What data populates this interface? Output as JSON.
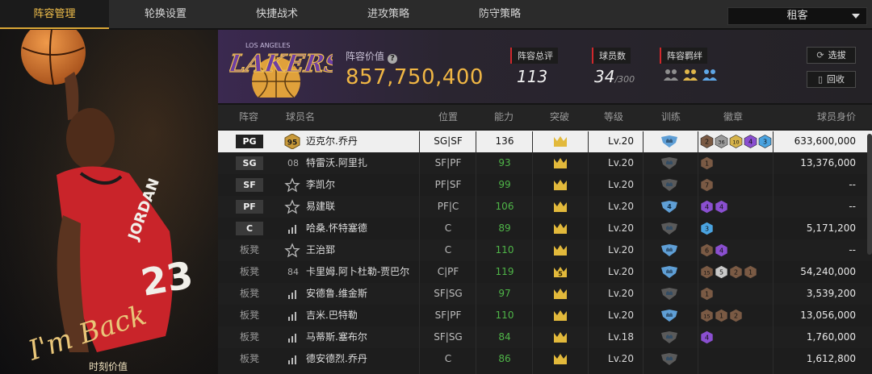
{
  "nav": {
    "tabs": [
      "阵容管理",
      "轮换设置",
      "快捷战术",
      "进攻策略",
      "防守策略"
    ],
    "active_tab": "阵容管理",
    "mode": "租客"
  },
  "promo": {
    "caption": "时刻价值",
    "jersey_text": "JORDAN",
    "jersey_number": "23",
    "signature": "I'm Back"
  },
  "team": {
    "logo_text": "LAKERS",
    "logo_subtext": "LOS ANGELES",
    "value_label": "阵容价值",
    "value": "857,750,400",
    "stats": [
      {
        "label": "阵容总评",
        "value": "113",
        "suffix": ""
      },
      {
        "label": "球员数",
        "value": "34",
        "suffix": "/300"
      },
      {
        "label": "阵容羁绊",
        "value": "",
        "suffix": ""
      }
    ],
    "buttons": {
      "draft": "选拔",
      "recycle": "回收"
    }
  },
  "table": {
    "headers": [
      "阵容",
      "球员名",
      "位置",
      "能力",
      "突破",
      "等级",
      "训练",
      "徽章",
      "球员身价"
    ],
    "rows": [
      {
        "slot": "PG",
        "rating": "95",
        "name": "迈克尔.乔丹",
        "position": "SG|SF",
        "ability": "136",
        "breakthrough": "",
        "level": "Lv.20",
        "badges": [
          "2",
          "36",
          "10",
          "4",
          "3"
        ],
        "price": "633,600,000"
      },
      {
        "slot": "SG",
        "rating": "08",
        "name": "特雷沃.阿里扎",
        "position": "SF|PF",
        "ability": "93",
        "breakthrough": "",
        "level": "Lv.20",
        "badges": [
          "1"
        ],
        "price": "13,376,000"
      },
      {
        "slot": "SF",
        "rating": "",
        "name": "李凯尔",
        "position": "PF|SF",
        "ability": "99",
        "breakthrough": "",
        "level": "Lv.20",
        "badges": [
          "7"
        ],
        "price": "--"
      },
      {
        "slot": "PF",
        "rating": "",
        "name": "易建联",
        "position": "PF|C",
        "ability": "106",
        "breakthrough": "",
        "level": "Lv.20",
        "train_level": "4",
        "badges": [
          "4",
          "4"
        ],
        "price": "--"
      },
      {
        "slot": "C",
        "rating": "",
        "name": "哈桑.怀特塞德",
        "position": "C",
        "ability": "89",
        "breakthrough": "",
        "level": "Lv.20",
        "badges": [
          "3"
        ],
        "price": "5,171,200"
      },
      {
        "slot": "板凳",
        "rating": "",
        "name": "王治郅",
        "position": "C",
        "ability": "110",
        "breakthrough": "",
        "level": "Lv.20",
        "badges": [
          "6",
          "4"
        ],
        "price": "--"
      },
      {
        "slot": "板凳",
        "rating": "84",
        "name": "卡里姆.阿卜杜勒-贾巴尔",
        "position": "C|PF",
        "ability": "119",
        "breakthrough": "5",
        "level": "Lv.20",
        "badges": [
          "15",
          "5",
          "2",
          "1"
        ],
        "price": "54,240,000"
      },
      {
        "slot": "板凳",
        "rating": "",
        "name": "安德鲁.维金斯",
        "position": "SF|SG",
        "ability": "97",
        "breakthrough": "",
        "level": "Lv.20",
        "badges": [
          "1"
        ],
        "price": "3,539,200"
      },
      {
        "slot": "板凳",
        "rating": "",
        "name": "吉米.巴特勒",
        "position": "SF|PF",
        "ability": "110",
        "breakthrough": "",
        "level": "Lv.20",
        "badges": [
          "15",
          "1",
          "2"
        ],
        "price": "13,056,000"
      },
      {
        "slot": "板凳",
        "rating": "",
        "name": "马蒂斯.塞布尔",
        "position": "SF|SG",
        "ability": "84",
        "breakthrough": "",
        "level": "Lv.18",
        "badges": [
          "4"
        ],
        "price": "1,760,000"
      },
      {
        "slot": "板凳",
        "rating": "",
        "name": "德安德烈.乔丹",
        "position": "C",
        "ability": "86",
        "breakthrough": "",
        "level": "Lv.20",
        "badges": [],
        "price": "1,612,800"
      }
    ]
  },
  "colors": {
    "accent_gold": "#f0b644",
    "ability_green": "#4fb548",
    "header_purple": "#3b2950",
    "selected_row": "#efefef"
  }
}
